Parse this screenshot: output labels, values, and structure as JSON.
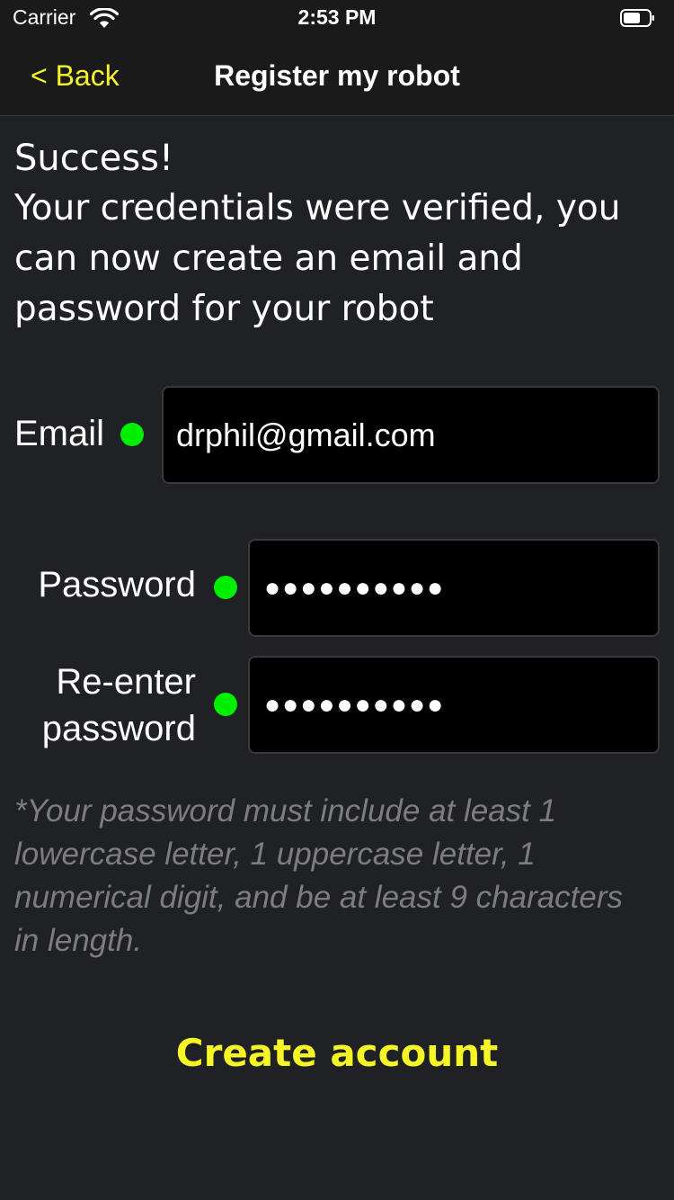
{
  "status_bar": {
    "carrier": "Carrier",
    "time": "2:53 PM"
  },
  "nav": {
    "back_label": "< Back",
    "title": "Register my robot"
  },
  "content": {
    "success_title": "Success!",
    "success_message": "Your credentials were verified, you can now create an email and password for your robot"
  },
  "form": {
    "email_label": "Email",
    "email_value": "drphil@gmail.com",
    "password_label": "Password",
    "password_mask": "●●●●●●●●●●",
    "reenter_label": "Re-enter password",
    "reenter_mask": "●●●●●●●●●●",
    "hint": "*Your password must include at least 1 lowercase letter, 1 uppercase letter, 1 numerical digit, and be at least 9 characters in length."
  },
  "actions": {
    "create_label": "Create account"
  },
  "colors": {
    "accent": "#f5f528",
    "background": "#202124",
    "valid_indicator": "#00ee00",
    "hint_text": "#7d7d80"
  },
  "icons": {
    "wifi": "wifi-icon",
    "battery": "battery-icon"
  }
}
